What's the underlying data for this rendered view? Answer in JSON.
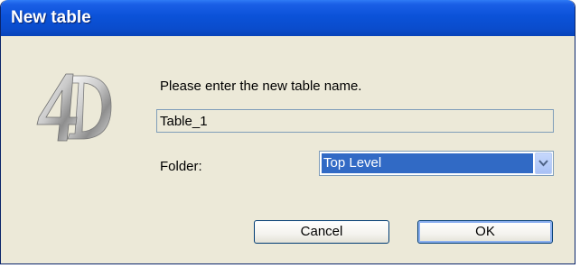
{
  "window": {
    "title": "New table"
  },
  "dialog": {
    "prompt": "Please enter the new table name.",
    "table_name": "Table_1",
    "folder_label": "Folder:",
    "folder_selected": "Top Level"
  },
  "buttons": {
    "cancel": "Cancel",
    "ok": "OK"
  },
  "colors": {
    "titlebar": "#0b52d8",
    "dialog_bg": "#ece9d8",
    "selection": "#316ac5",
    "button_border": "#003c74"
  },
  "icons": {
    "logo": "4d-logo",
    "dropdown": "chevron-down-icon"
  }
}
